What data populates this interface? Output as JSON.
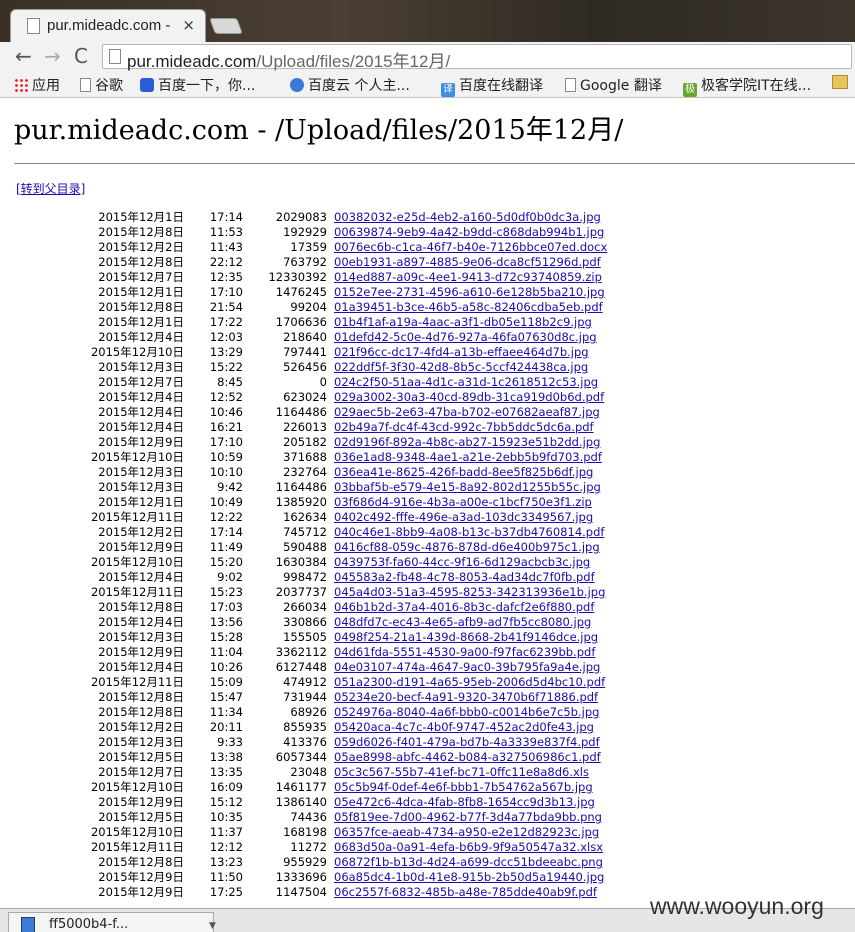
{
  "browser": {
    "tab_title": "pur.mideadc.com -",
    "tab_close": "×",
    "url_host": "pur.mideadc.com",
    "url_path": "/Upload/files/2015年12月/",
    "back": "←",
    "forward": "→",
    "reload": "C"
  },
  "bookmarks": [
    {
      "label": "应用",
      "icon": "apps-icon"
    },
    {
      "label": "谷歌",
      "icon": "doc-icon"
    },
    {
      "label": "百度一下，你...",
      "icon": "paw-icon"
    },
    {
      "label": "百度云 个人主...",
      "icon": "cloud-icon"
    },
    {
      "label": "百度在线翻译",
      "icon": "translate-icon",
      "glyph": "译"
    },
    {
      "label": "Google 翻译",
      "icon": "doc-icon"
    },
    {
      "label": "极客学院IT在线...",
      "icon": "jike-icon",
      "glyph": "极"
    }
  ],
  "page": {
    "title": "pur.mideadc.com - /Upload/files/2015年12月/",
    "parent_link": "[转到父目录]"
  },
  "files": [
    {
      "date": "2015年12月1日",
      "time": "17:14",
      "size": "2029083",
      "name": "00382032-e25d-4eb2-a160-5d0df0b0dc3a.jpg"
    },
    {
      "date": "2015年12月8日",
      "time": "11:53",
      "size": "192929",
      "name": "00639874-9eb9-4a42-b9dd-c868dab994b1.jpg"
    },
    {
      "date": "2015年12月2日",
      "time": "11:43",
      "size": "17359",
      "name": "0076ec6b-c1ca-46f7-b40e-7126bbce07ed.docx"
    },
    {
      "date": "2015年12月8日",
      "time": "22:12",
      "size": "763792",
      "name": "00eb1931-a897-4885-9e06-dca8cf51296d.pdf"
    },
    {
      "date": "2015年12月7日",
      "time": "12:35",
      "size": "12330392",
      "name": "014ed887-a09c-4ee1-9413-d72c93740859.zip"
    },
    {
      "date": "2015年12月1日",
      "time": "17:10",
      "size": "1476245",
      "name": "0152e7ee-2731-4596-a610-6e128b5ba210.jpg"
    },
    {
      "date": "2015年12月8日",
      "time": "21:54",
      "size": "99204",
      "name": "01a39451-b3ce-46b5-a58c-82406cdba5eb.pdf"
    },
    {
      "date": "2015年12月1日",
      "time": "17:22",
      "size": "1706636",
      "name": "01b4f1af-a19a-4aac-a3f1-db05e118b2c9.jpg"
    },
    {
      "date": "2015年12月4日",
      "time": "12:03",
      "size": "218640",
      "name": "01defd42-5c0e-4d76-927a-46fa07630d8c.jpg"
    },
    {
      "date": "2015年12月10日",
      "time": "13:29",
      "size": "797441",
      "name": "021f96cc-dc17-4fd4-a13b-effaee464d7b.jpg"
    },
    {
      "date": "2015年12月3日",
      "time": "15:22",
      "size": "526456",
      "name": "022ddf5f-3f30-42d8-8b5c-5ccf424438ca.jpg"
    },
    {
      "date": "2015年12月7日",
      "time": "8:45",
      "size": "0",
      "name": "024c2f50-51aa-4d1c-a31d-1c2618512c53.jpg"
    },
    {
      "date": "2015年12月4日",
      "time": "12:52",
      "size": "623024",
      "name": "029a3002-30a3-40cd-89db-31ca919d0b6d.pdf"
    },
    {
      "date": "2015年12月4日",
      "time": "10:46",
      "size": "1164486",
      "name": "029aec5b-2e63-47ba-b702-e07682aeaf87.jpg"
    },
    {
      "date": "2015年12月4日",
      "time": "16:21",
      "size": "226013",
      "name": "02b49a7f-dc4f-43cd-992c-7bb5ddc5dc6a.pdf"
    },
    {
      "date": "2015年12月9日",
      "time": "17:10",
      "size": "205182",
      "name": "02d9196f-892a-4b8c-ab27-15923e51b2dd.jpg"
    },
    {
      "date": "2015年12月10日",
      "time": "10:59",
      "size": "371688",
      "name": "036e1ad8-9348-4ae1-a21e-2ebb5b9fd703.pdf"
    },
    {
      "date": "2015年12月3日",
      "time": "10:10",
      "size": "232764",
      "name": "036ea41e-8625-426f-badd-8ee5f825b6df.jpg"
    },
    {
      "date": "2015年12月3日",
      "time": "9:42",
      "size": "1164486",
      "name": "03bbaf5b-e579-4e15-8a92-802d1255b55c.jpg"
    },
    {
      "date": "2015年12月1日",
      "time": "10:49",
      "size": "1385920",
      "name": "03f686d4-916e-4b3a-a00e-c1bcf750e3f1.zip"
    },
    {
      "date": "2015年12月11日",
      "time": "12:22",
      "size": "162634",
      "name": "0402c492-fffe-496e-a3ad-103dc3349567.jpg"
    },
    {
      "date": "2015年12月2日",
      "time": "17:14",
      "size": "745712",
      "name": "040c46e1-8bb9-4a08-b13c-b37db4760814.pdf"
    },
    {
      "date": "2015年12月9日",
      "time": "11:49",
      "size": "590488",
      "name": "0416cf88-059c-4876-878d-d6e400b975c1.jpg"
    },
    {
      "date": "2015年12月10日",
      "time": "15:20",
      "size": "1630384",
      "name": "0439753f-fa60-44cc-9f16-6d129acbcb3c.jpg"
    },
    {
      "date": "2015年12月4日",
      "time": "9:02",
      "size": "998472",
      "name": "045583a2-fb48-4c78-8053-4ad34dc7f0fb.pdf"
    },
    {
      "date": "2015年12月11日",
      "time": "15:23",
      "size": "2037737",
      "name": "045a4d03-51a3-4595-8253-342313936e1b.jpg"
    },
    {
      "date": "2015年12月8日",
      "time": "17:03",
      "size": "266034",
      "name": "046b1b2d-37a4-4016-8b3c-dafcf2e6f880.pdf"
    },
    {
      "date": "2015年12月4日",
      "time": "13:56",
      "size": "330866",
      "name": "048dfd7c-ec43-4e65-afb9-ad7fb5cc8080.jpg"
    },
    {
      "date": "2015年12月3日",
      "time": "15:28",
      "size": "155505",
      "name": "0498f254-21a1-439d-8668-2b41f9146dce.jpg"
    },
    {
      "date": "2015年12月9日",
      "time": "11:04",
      "size": "3362112",
      "name": "04d61fda-5551-4530-9a00-f97fac6239bb.pdf"
    },
    {
      "date": "2015年12月4日",
      "time": "10:26",
      "size": "6127448",
      "name": "04e03107-474a-4647-9ac0-39b795fa9a4e.jpg"
    },
    {
      "date": "2015年12月11日",
      "time": "15:09",
      "size": "474912",
      "name": "051a2300-d191-4a65-95eb-2006d5d4bc10.pdf"
    },
    {
      "date": "2015年12月8日",
      "time": "15:47",
      "size": "731944",
      "name": "05234e20-becf-4a91-9320-3470b6f71886.pdf"
    },
    {
      "date": "2015年12月8日",
      "time": "11:34",
      "size": "68926",
      "name": "0524976a-8040-4a6f-bbb0-c0014b6e7c5b.jpg"
    },
    {
      "date": "2015年12月2日",
      "time": "20:11",
      "size": "855935",
      "name": "05420aca-4c7c-4b0f-9747-452ac2d0fe43.jpg"
    },
    {
      "date": "2015年12月3日",
      "time": "9:33",
      "size": "413376",
      "name": "059d6026-f401-479a-bd7b-4a3339e837f4.pdf"
    },
    {
      "date": "2015年12月5日",
      "time": "13:38",
      "size": "6057344",
      "name": "05ae8998-abfc-4462-b084-a327506986c1.pdf"
    },
    {
      "date": "2015年12月7日",
      "time": "13:35",
      "size": "23048",
      "name": "05c3c567-55b7-41ef-bc71-0ffc11e8a8d6.xls"
    },
    {
      "date": "2015年12月10日",
      "time": "16:09",
      "size": "1461177",
      "name": "05c5b94f-0def-4e6f-bbb1-7b54762a567b.jpg"
    },
    {
      "date": "2015年12月9日",
      "time": "15:12",
      "size": "1386140",
      "name": "05e472c6-4dca-4fab-8fb8-1654cc9d3b13.jpg"
    },
    {
      "date": "2015年12月5日",
      "time": "10:35",
      "size": "74436",
      "name": "05f819ee-7d00-4962-b77f-3d4a77bda9bb.png"
    },
    {
      "date": "2015年12月10日",
      "time": "11:37",
      "size": "168198",
      "name": "06357fce-aeab-4734-a950-e2e12d82923c.jpg"
    },
    {
      "date": "2015年12月11日",
      "time": "12:12",
      "size": "11272",
      "name": "0683d50a-0a91-4efa-b6b9-9f9a50547a32.xlsx"
    },
    {
      "date": "2015年12月8日",
      "time": "13:23",
      "size": "955929",
      "name": "06872f1b-b13d-4d24-a699-dcc51bdeeabc.png"
    },
    {
      "date": "2015年12月9日",
      "time": "11:50",
      "size": "1333696",
      "name": "06a85dc4-1b0d-41e8-915b-2b50d5a19440.jpg"
    },
    {
      "date": "2015年12月9日",
      "time": "17:25",
      "size": "1147504",
      "name": "06c2557f-6832-485b-a48e-785dde40ab9f.pdf"
    }
  ],
  "download": {
    "name": "ff5000b4-f..."
  },
  "watermark": {
    "text": "www.wooyun.org"
  }
}
